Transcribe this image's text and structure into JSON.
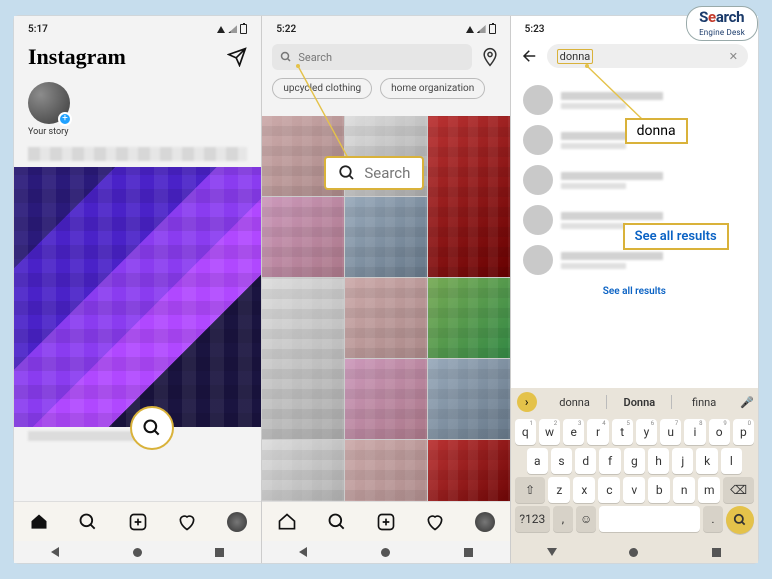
{
  "watermark": {
    "line1_pre": "S",
    "line1_e": "e",
    "line1_rest": "arch",
    "line2": "Engine Desk"
  },
  "phone1": {
    "time": "5:17",
    "logo": "Instagram",
    "story_label": "Your story",
    "nav": [
      "home",
      "search",
      "create",
      "activity",
      "profile"
    ]
  },
  "phone2": {
    "time": "5:22",
    "search_placeholder": "Search",
    "chips": [
      "upcycled clothing",
      "home organization"
    ],
    "callout": "Search"
  },
  "phone3": {
    "time": "5:23",
    "query": "donna",
    "callout_query": "donna",
    "callout_seeall": "See all results",
    "see_all": "See all results",
    "suggestions": [
      "donna",
      "Donna",
      "finna"
    ],
    "keyboard": {
      "row1": [
        "q",
        "w",
        "e",
        "r",
        "t",
        "y",
        "u",
        "i",
        "o",
        "p"
      ],
      "nums": [
        "1",
        "2",
        "3",
        "4",
        "5",
        "6",
        "7",
        "8",
        "9",
        "0"
      ],
      "row2": [
        "a",
        "s",
        "d",
        "f",
        "g",
        "h",
        "j",
        "k",
        "l"
      ],
      "row3": [
        "z",
        "x",
        "c",
        "v",
        "b",
        "n",
        "m"
      ],
      "shift": "⇧",
      "bksp": "⌫",
      "numkey": "?123",
      "comma": ",",
      "emoji": "☺",
      "dot": "."
    }
  }
}
